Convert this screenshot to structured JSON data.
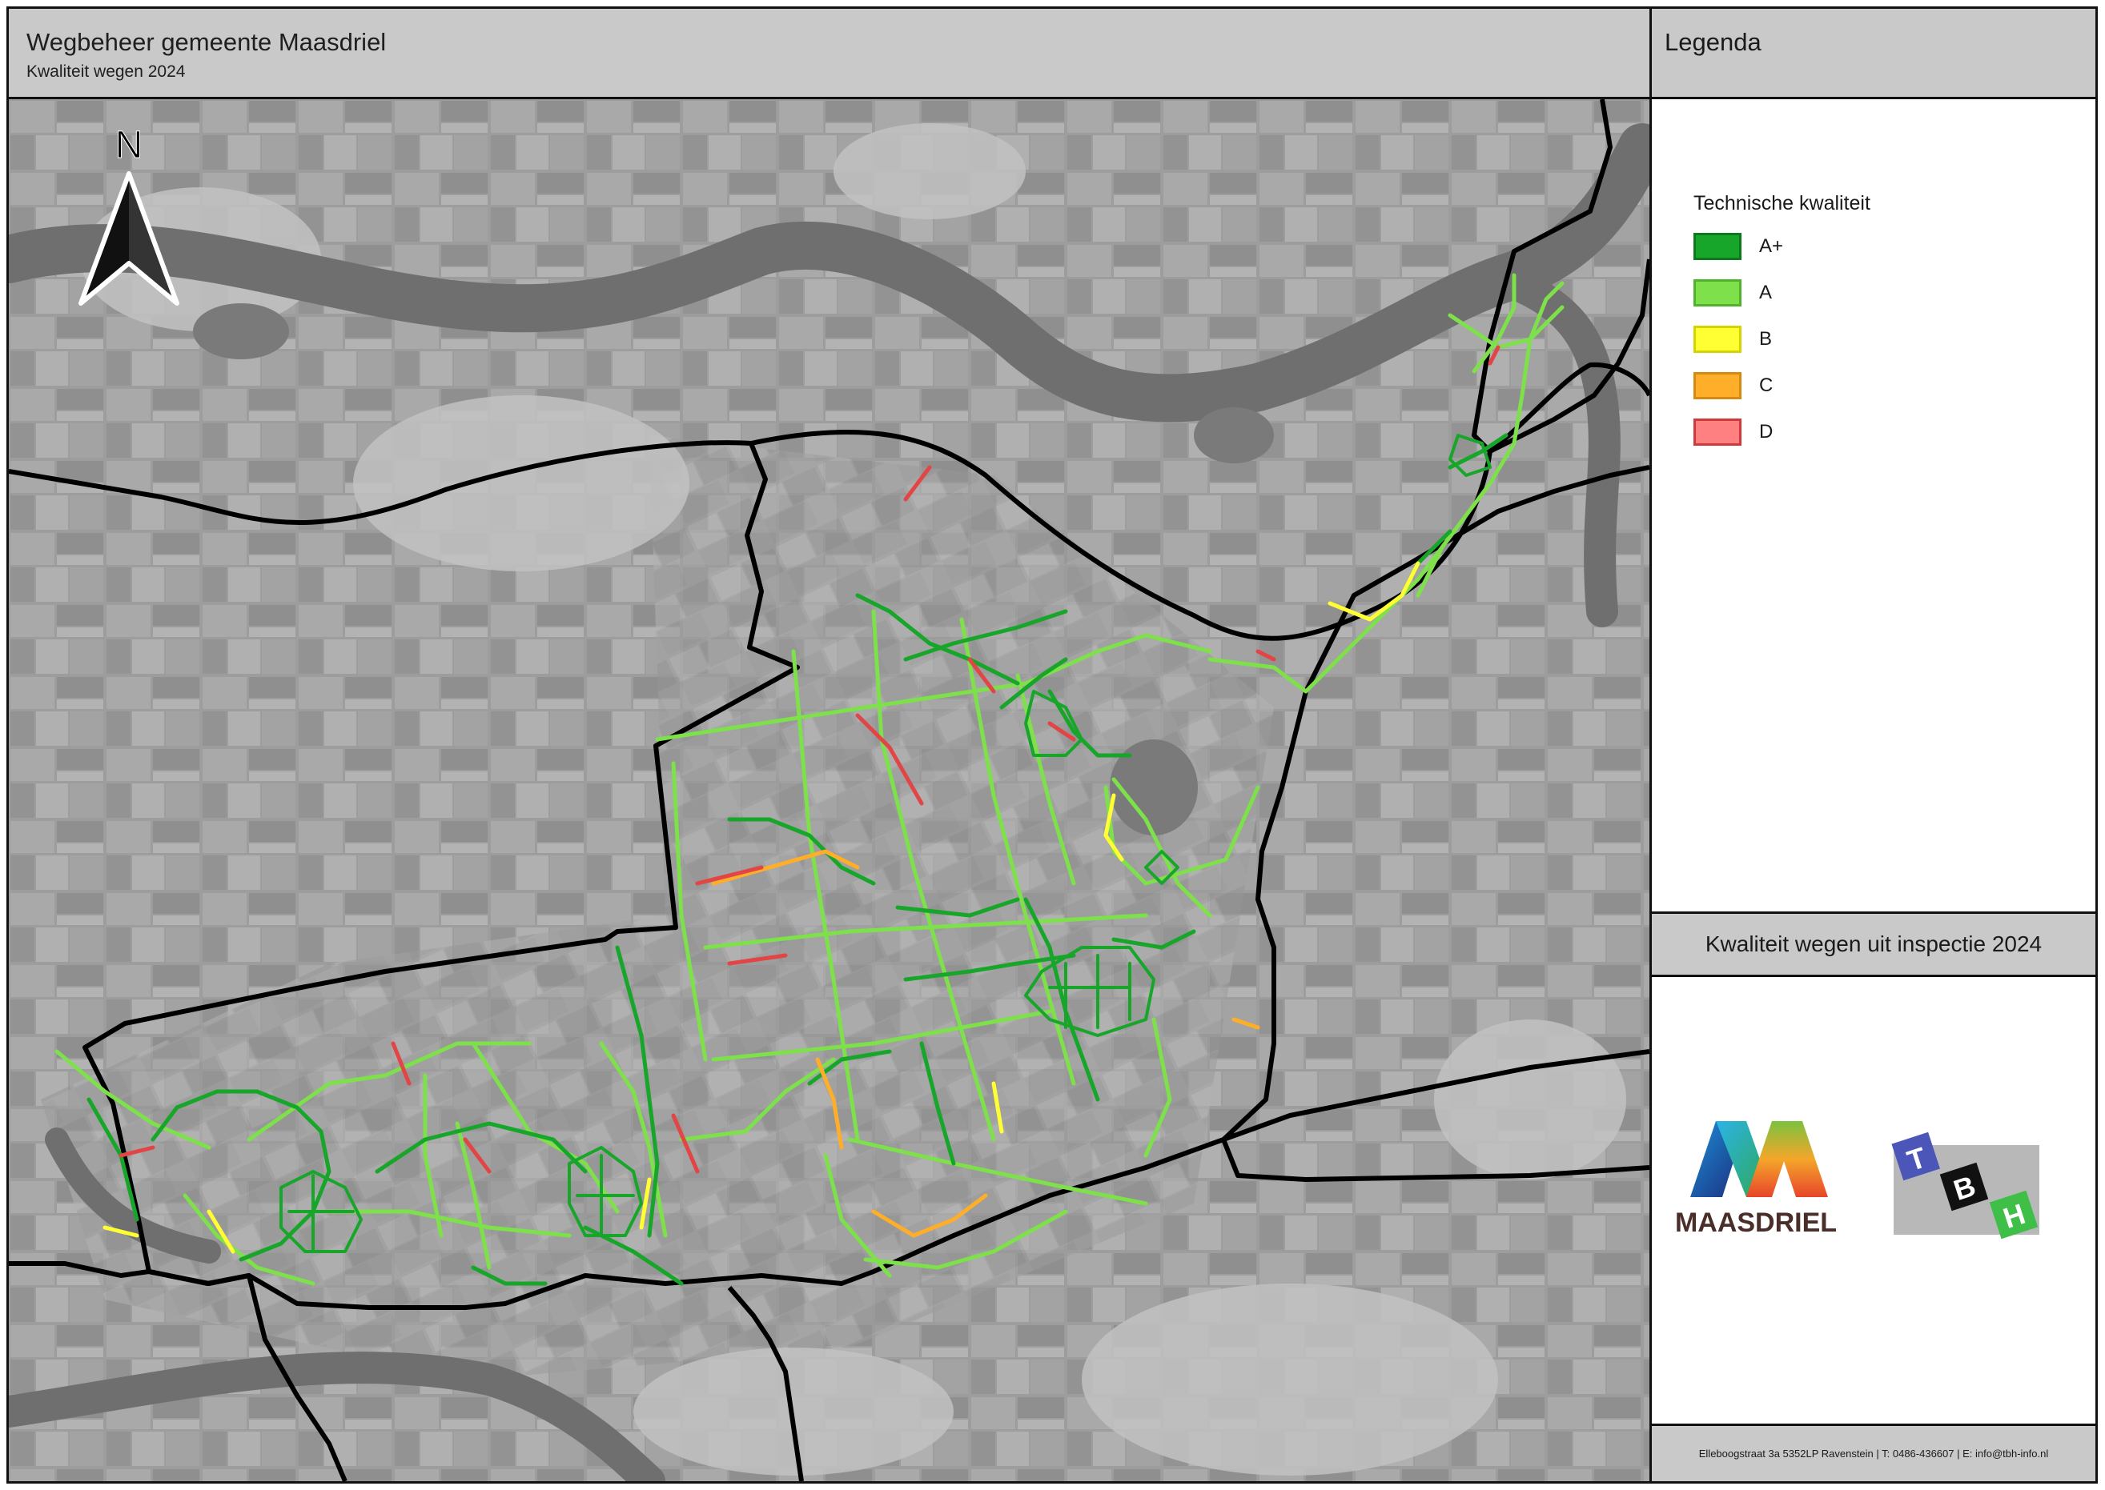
{
  "header": {
    "title": "Wegbeheer gemeente Maasdriel",
    "subtitle": "Kwaliteit wegen 2024"
  },
  "map": {
    "north_arrow_label": "N",
    "basemap": "grayscale aerial photo"
  },
  "legend": {
    "title": "Legenda",
    "section_title": "Technische kwaliteit",
    "items": [
      {
        "label": "A+",
        "fill": "#17a52a",
        "border": "#0d7a1c"
      },
      {
        "label": "A",
        "fill": "#7ee04a",
        "border": "#4fb42c"
      },
      {
        "label": "B",
        "fill": "#ffff33",
        "border": "#d4d400"
      },
      {
        "label": "C",
        "fill": "#ffae2a",
        "border": "#d88a10"
      },
      {
        "label": "D",
        "fill": "#ff8080",
        "border": "#d23a3a"
      }
    ]
  },
  "inspection": {
    "title": "Kwaliteit wegen uit inspectie 2024"
  },
  "logos": {
    "maasdriel_label": "MAASDRIEL",
    "tbh_letters": [
      "T",
      "B",
      "H"
    ],
    "tbh_colors": {
      "T": "#4b56b8",
      "B": "#111111",
      "H": "#3fbf47"
    }
  },
  "footer": {
    "text": "Elleboogstraat 3a 5352LP Ravenstein | T: 0486-436607 | E: info@tbh-info.nl"
  }
}
